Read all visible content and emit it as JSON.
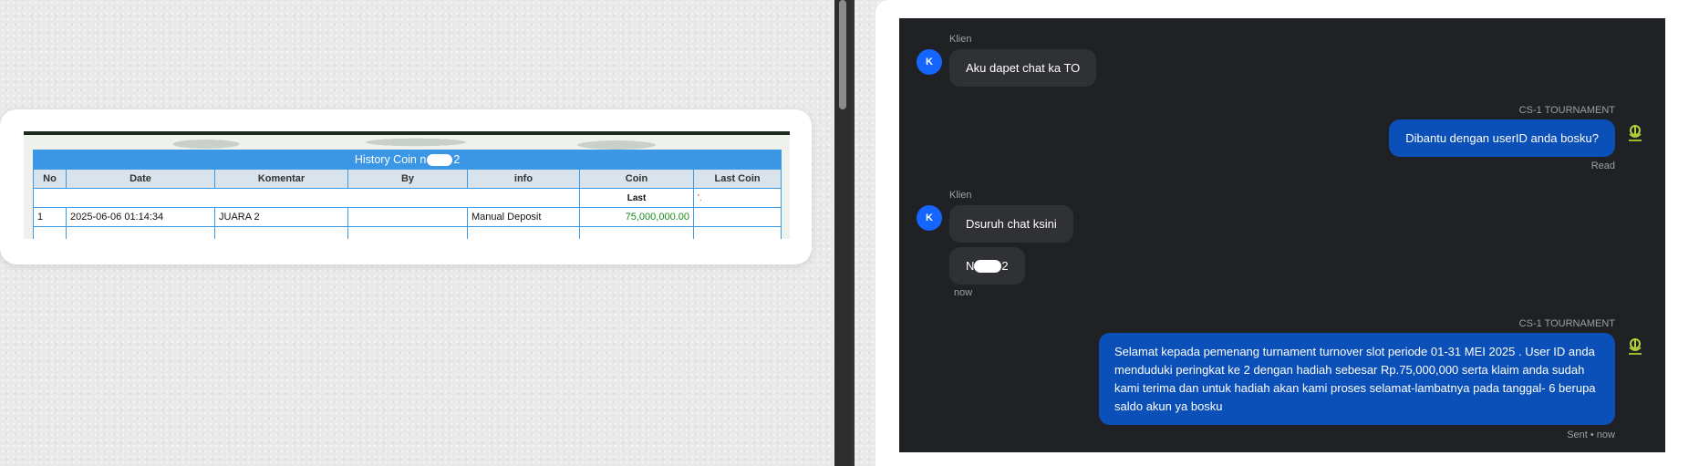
{
  "history": {
    "title_prefix": "History Coin n",
    "title_suffix": "2",
    "columns": [
      "No",
      "Date",
      "Komentar",
      "By",
      "info",
      "Coin",
      "Last Coin"
    ],
    "last_label": "Last",
    "last_value": "'.",
    "rows": [
      {
        "no": "1",
        "date": "2025-06-06 01:14:34",
        "komentar": "JUARA 2",
        "by": "",
        "info": "Manual Deposit",
        "coin": "75,000,000.00",
        "last_coin": ""
      }
    ]
  },
  "chat": {
    "client_label": "Klien",
    "agent_label": "CS-1 TOURNAMENT",
    "avatar_letter": "K",
    "messages": {
      "m1": "Aku dapet chat ka TO",
      "m2": "Dibantu dengan userID anda bosku?",
      "m2_status": "Read",
      "m3": "Dsuruh chat ksini",
      "m4_prefix": "N",
      "m4_suffix": "2",
      "m4_time": "now",
      "m5": "Selamat kepada pemenang turnament turnover slot periode 01-31 MEI 2025 . User ID anda menduduki peringkat ke 2 dengan hadiah sebesar Rp.75,000,000 serta klaim anda sudah kami terima dan untuk hadiah akan kami proses selamat-lambatnya pada tanggal- 6 berupa saldo akun ya bosku",
      "m5_status": "Sent • now"
    }
  },
  "colors": {
    "table_header": "#3c96e6",
    "chat_bg": "#202124",
    "bubble_in": "#303134",
    "bubble_out": "#0b4fb8",
    "avatar": "#1565ff",
    "coin_green": "#1a8a1a"
  }
}
